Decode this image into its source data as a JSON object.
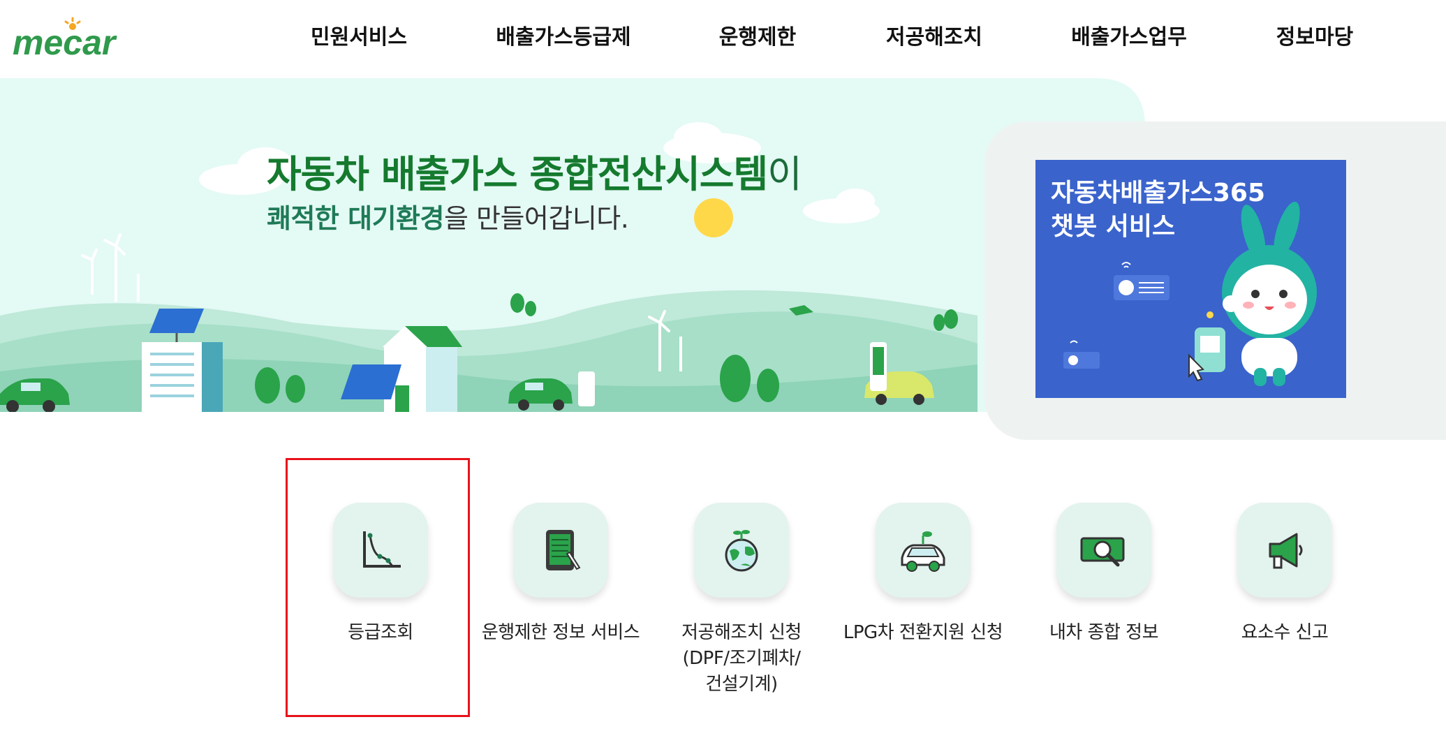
{
  "brand": {
    "logo_text": "mecar"
  },
  "nav": {
    "items": [
      {
        "label": "민원서비스"
      },
      {
        "label": "배출가스등급제"
      },
      {
        "label": "운행제한"
      },
      {
        "label": "저공해조치"
      },
      {
        "label": "배출가스업무"
      },
      {
        "label": "정보마당"
      }
    ]
  },
  "banner": {
    "headline_main": "자동차 배출가스 종합전산시스템",
    "headline_tail": "이",
    "subline_emphasis": "쾌적한 대기환경",
    "subline_rest": "을 만들어갑니다."
  },
  "chatbot": {
    "title_line1": "자동차배출가스365",
    "title_line2": "챗봇 서비스"
  },
  "quick_menu": [
    {
      "label": "등급조회",
      "icon": "graph-curve-icon"
    },
    {
      "label": "운행제한 정보 서비스",
      "icon": "tablet-document-icon"
    },
    {
      "label": "저공해조치 신청\n(DPF/조기폐차/\n건설기계)",
      "icon": "earth-sprout-icon"
    },
    {
      "label": "LPG차 전환지원 신청",
      "icon": "eco-car-icon"
    },
    {
      "label": "내차 종합 정보",
      "icon": "money-magnifier-icon"
    },
    {
      "label": "요소수 신고",
      "icon": "megaphone-icon"
    }
  ],
  "colors": {
    "brand_green": "#157a2e",
    "banner_bg": "#e4faf5",
    "chatbot_bg": "#3a63cc",
    "quick_icon_bg": "#e3f3ee",
    "highlight": "#e8121b"
  }
}
